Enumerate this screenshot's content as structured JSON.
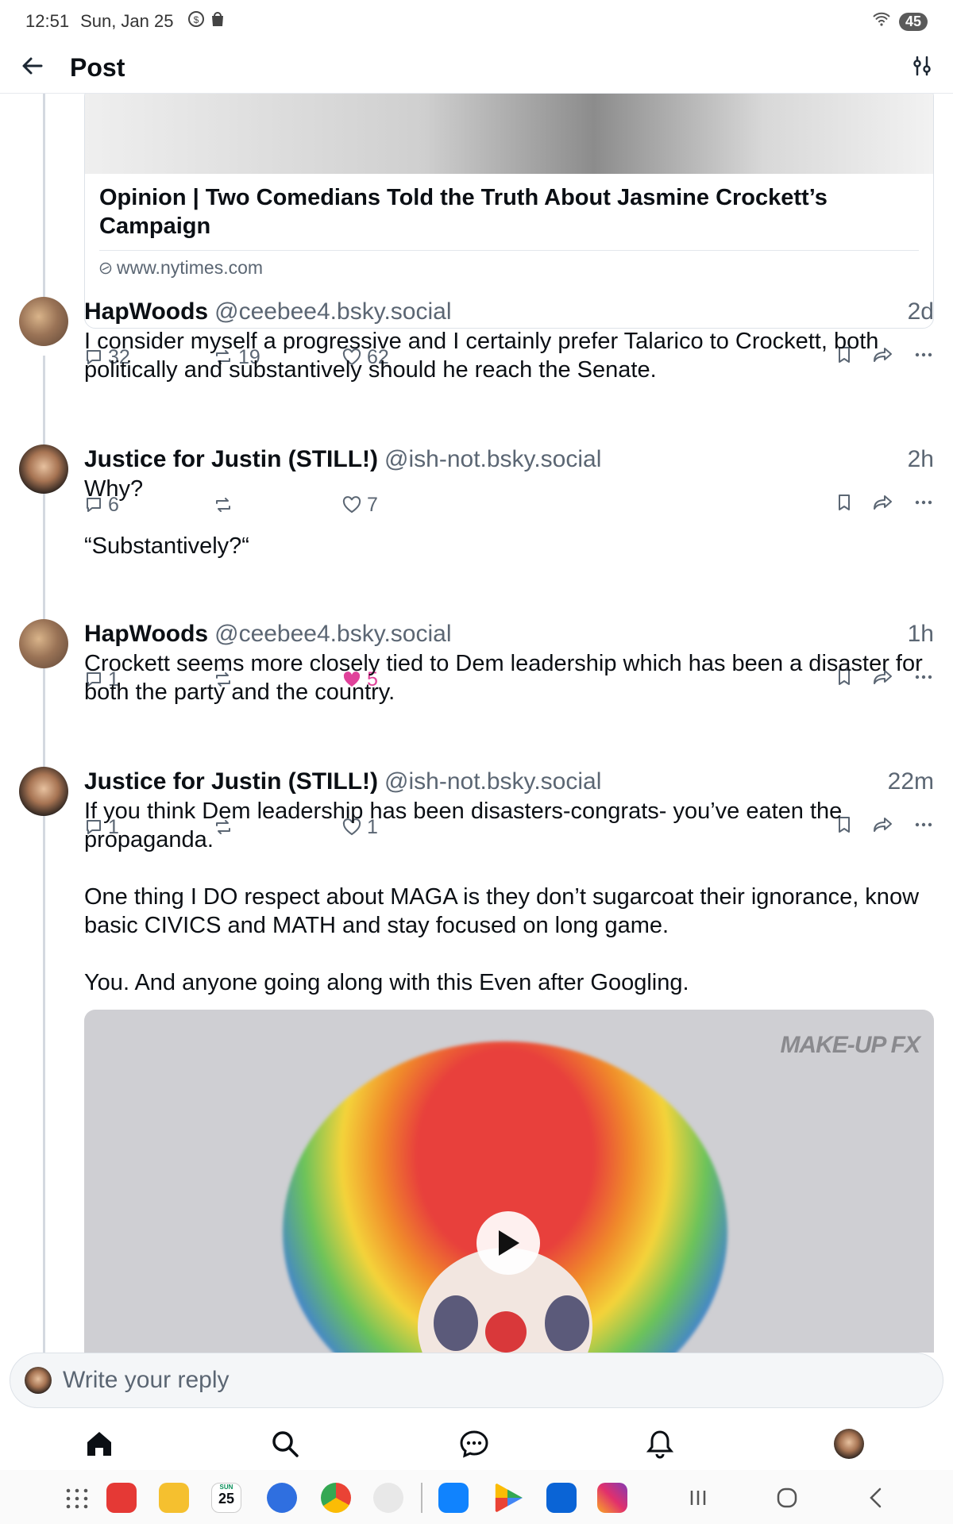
{
  "status_bar": {
    "time": "12:51",
    "date": "Sun, Jan 25",
    "battery": "45"
  },
  "header": {
    "title": "Post"
  },
  "link_card": {
    "title": "Opinion | Two Comedians Told the Truth About Jasmine Crockett’s Campaign",
    "domain": "www.nytimes.com",
    "replies": "32",
    "reposts": "19",
    "likes": "62"
  },
  "posts": [
    {
      "name": "HapWoods",
      "handle": "@ceebee4.bsky.social",
      "time": "2d",
      "text": "I consider myself a progressive and I certainly prefer Talarico to Crockett, both politically and substantively should he reach the Senate.",
      "replies": "6",
      "reposts": "",
      "likes": "7"
    },
    {
      "name": "Justice for Justin (STILL!)",
      "handle": "@ish-not.bsky.social",
      "time": "2h",
      "text": "Why?\n\n“Substantively?“",
      "replies": "1",
      "reposts": "",
      "likes": "5"
    },
    {
      "name": "HapWoods",
      "handle": "@ceebee4.bsky.social",
      "time": "1h",
      "text": "Crockett seems more closely tied to Dem leadership which has been a disaster for both the party and the country.",
      "replies": "1",
      "reposts": "",
      "likes": "1"
    },
    {
      "name": "Justice for Justin (STILL!)",
      "handle": "@ish-not.bsky.social",
      "time": "22m",
      "text": "If you think Dem leadership has been disasters-congrats- you’ve eaten the propaganda.\n\nOne thing I DO respect about  MAGA is they don’t sugarcoat their ignorance, know basic CIVICS and MATH and stay focused on long game.\n\nYou. And anyone going along with this Even after Googling."
    }
  ],
  "video": {
    "watermark": "MAKE-UP FX"
  },
  "reply_bar": {
    "placeholder": "Write your reply"
  },
  "system": {
    "calendar_day": "25",
    "calendar_label": "SUN"
  },
  "colors": {
    "accent": "#1083fe",
    "like": "#e0429a",
    "muted": "#5b6673"
  }
}
